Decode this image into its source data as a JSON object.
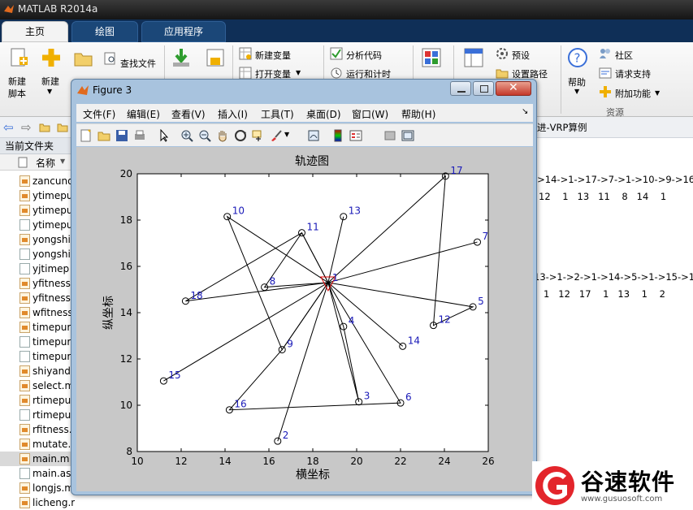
{
  "app": {
    "title": "MATLAB R2014a"
  },
  "tabs": [
    {
      "label": "主页"
    },
    {
      "label": "绘图"
    },
    {
      "label": "应用程序"
    }
  ],
  "ribbon": {
    "new_script": "新建\n脚本",
    "new_script_l1": "新建",
    "new_script_l2": "脚本",
    "new": "新建",
    "open_partial": "打开",
    "find_files": "查找文件",
    "import_partial": "导入",
    "save_partial": "保存",
    "new_variable": "新建变量",
    "open_variable": "打开变量",
    "analyze_code": "分析代码",
    "run_and_time": "运行和计时",
    "simulink_partial": "Simulink",
    "layout_partial": "布局",
    "preferences": "预设",
    "set_path": "设置路径",
    "help": "帮助",
    "community": "社区",
    "request_support": "请求支持",
    "addons": "附加功能",
    "resources_section": "资源"
  },
  "left_panel": {
    "title": "当前文件夹",
    "column_name": "名称",
    "files": [
      {
        "name": "zancund",
        "type": "m"
      },
      {
        "name": "ytimepu",
        "type": "m"
      },
      {
        "name": "ytimepu",
        "type": "m"
      },
      {
        "name": "ytimepu",
        "type": "txt"
      },
      {
        "name": "yongshi",
        "type": "m"
      },
      {
        "name": "yongshi",
        "type": "txt"
      },
      {
        "name": "yjtimep",
        "type": "txt"
      },
      {
        "name": "yfitness",
        "type": "m"
      },
      {
        "name": "yfitness",
        "type": "m"
      },
      {
        "name": "wfitness",
        "type": "m"
      },
      {
        "name": "timepur",
        "type": "m"
      },
      {
        "name": "timepur",
        "type": "txt"
      },
      {
        "name": "timepur",
        "type": "txt"
      },
      {
        "name": "shiyand",
        "type": "m"
      },
      {
        "name": "select.m",
        "type": "m"
      },
      {
        "name": "rtimepu",
        "type": "m"
      },
      {
        "name": "rtimepu",
        "type": "txt"
      },
      {
        "name": "rfitness.",
        "type": "m"
      },
      {
        "name": "mutate.",
        "type": "m"
      },
      {
        "name": "main.m",
        "type": "m"
      },
      {
        "name": "main.as",
        "type": "txt"
      },
      {
        "name": "longjs.m",
        "type": "m"
      },
      {
        "name": "licheng.m",
        "type": "m"
      }
    ]
  },
  "right_panel": {
    "path_partial": "进-VRP算例",
    "route1": "->14->1->17->7->1->10->9->16",
    "nums1": "12    1   13   11    8   14    1",
    "route2": "13->1->2->1->14->5->1->15->1",
    "nums2": "1   12   17    1   13    1    2"
  },
  "figure": {
    "window_title": "Figure 3",
    "menu": [
      "文件(F)",
      "编辑(E)",
      "查看(V)",
      "插入(I)",
      "工具(T)",
      "桌面(D)",
      "窗口(W)",
      "帮助(H)"
    ]
  },
  "chart_data": {
    "type": "scatter",
    "title": "轨迹图",
    "xlabel": "横坐标",
    "ylabel": "纵坐标",
    "xlim": [
      10,
      26
    ],
    "ylim": [
      8,
      20
    ],
    "xticks": [
      10,
      12,
      14,
      16,
      18,
      20,
      22,
      24,
      26
    ],
    "yticks": [
      8,
      10,
      12,
      14,
      16,
      18,
      20
    ],
    "depot": {
      "label": "1",
      "x": 18.7,
      "y": 15.3
    },
    "points": [
      {
        "label": "2",
        "x": 16.4,
        "y": 8.45
      },
      {
        "label": "3",
        "x": 20.1,
        "y": 10.15
      },
      {
        "label": "4",
        "x": 19.4,
        "y": 13.4
      },
      {
        "label": "5",
        "x": 25.3,
        "y": 14.25
      },
      {
        "label": "6",
        "x": 22.0,
        "y": 10.1
      },
      {
        "label": "7",
        "x": 25.5,
        "y": 17.05
      },
      {
        "label": "8",
        "x": 15.8,
        "y": 15.1
      },
      {
        "label": "9",
        "x": 16.6,
        "y": 12.4
      },
      {
        "label": "10",
        "x": 14.1,
        "y": 18.15
      },
      {
        "label": "11",
        "x": 17.5,
        "y": 17.45
      },
      {
        "label": "12",
        "x": 23.5,
        "y": 13.45
      },
      {
        "label": "13",
        "x": 19.4,
        "y": 18.15
      },
      {
        "label": "14",
        "x": 22.1,
        "y": 12.55
      },
      {
        "label": "15",
        "x": 11.2,
        "y": 11.05
      },
      {
        "label": "16",
        "x": 14.2,
        "y": 9.8
      },
      {
        "label": "17",
        "x": 24.05,
        "y": 19.9
      },
      {
        "label": "18",
        "x": 12.2,
        "y": 14.5
      }
    ],
    "routes": [
      [
        "1",
        "2",
        "1"
      ],
      [
        "1",
        "3",
        "4",
        "1"
      ],
      [
        "1",
        "6",
        "16",
        "9",
        "1"
      ],
      [
        "1",
        "5",
        "12",
        "17",
        "1"
      ],
      [
        "1",
        "14",
        "1"
      ],
      [
        "1",
        "7",
        "1"
      ],
      [
        "1",
        "10",
        "9",
        "1"
      ],
      [
        "1",
        "11",
        "18",
        "1"
      ],
      [
        "1",
        "8",
        "11",
        "1"
      ],
      [
        "1",
        "13",
        "1"
      ],
      [
        "1",
        "15",
        "1"
      ]
    ]
  },
  "watermark": {
    "brand": "谷速软件",
    "url": "www.gusuosoft.com"
  }
}
